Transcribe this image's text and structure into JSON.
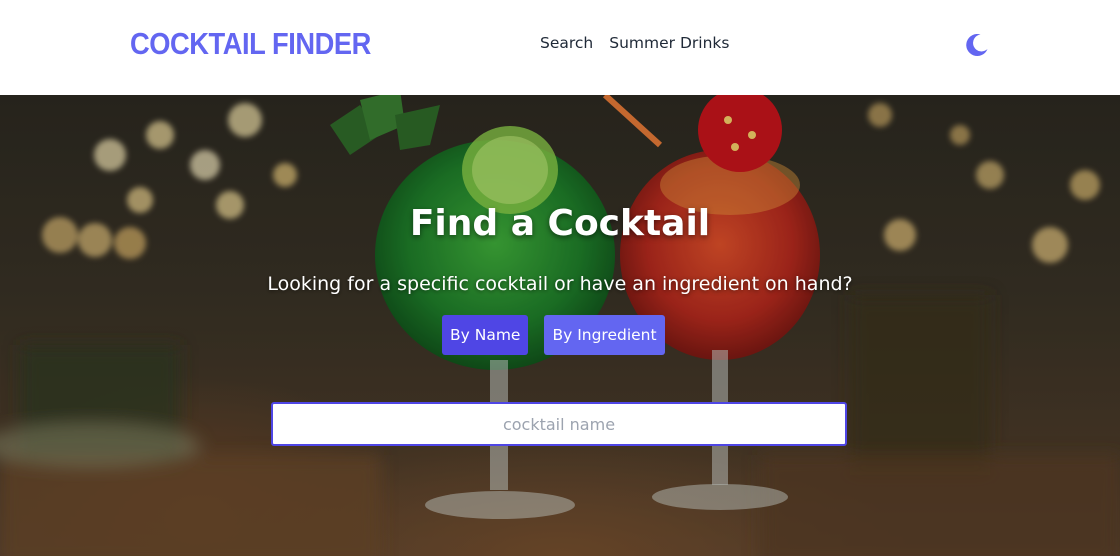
{
  "colors": {
    "accent": "#6366f1",
    "accent_dark": "#4f46e5",
    "nav_text": "#1f2937",
    "hero_text": "#ffffff"
  },
  "navbar": {
    "logo": "COCKTAIL FINDER",
    "links": [
      {
        "label": "Search"
      },
      {
        "label": "Summer Drinks"
      }
    ],
    "theme_toggle_icon": "moon-icon"
  },
  "hero": {
    "title": "Find a Cocktail",
    "subtitle": "Looking for a specific cocktail or have an ingredient on hand?",
    "buttons": [
      {
        "label": "By Name",
        "active": true
      },
      {
        "label": "By Ingredient",
        "active": false
      }
    ],
    "search": {
      "value": "",
      "placeholder": "cocktail name"
    }
  }
}
